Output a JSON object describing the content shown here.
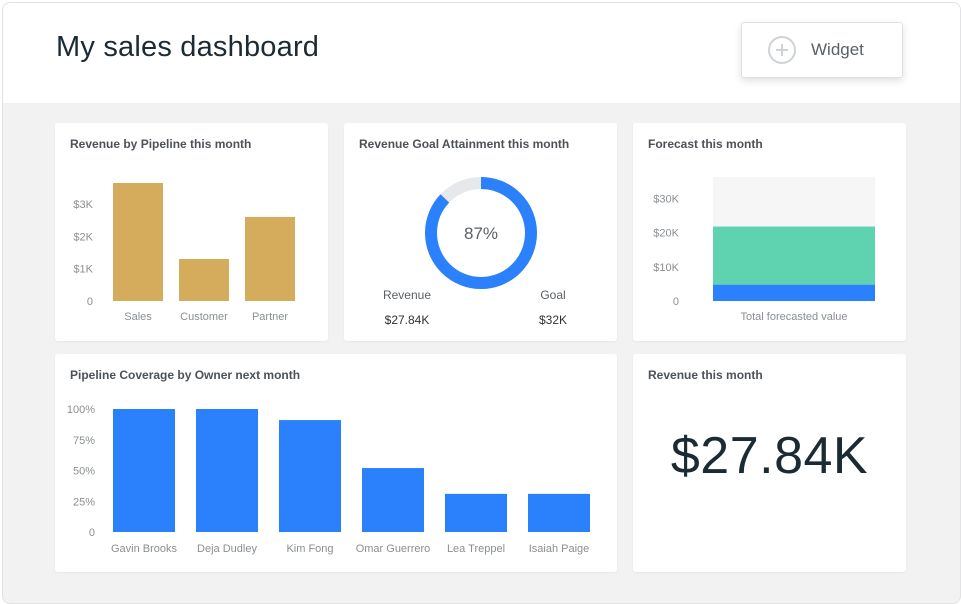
{
  "header": {
    "title": "My sales dashboard",
    "widget_button_label": "Widget",
    "widget_button_icon": "plus-circle-icon"
  },
  "colors": {
    "gold": "#d4ac5b",
    "blue": "#2b80fb",
    "teal": "#5fd3b0",
    "track": "#e6e8ec",
    "forecast_bg": "#f6f6f6",
    "text": "#1c2a33",
    "muted": "#8a8f93"
  },
  "cards": {
    "pipeline_revenue": {
      "title": "Revenue by Pipeline this month"
    },
    "goal": {
      "title": "Revenue Goal Attainment this month"
    },
    "forecast": {
      "title": "Forecast this month"
    },
    "coverage": {
      "title": "Pipeline Coverage by Owner next month"
    },
    "revenue": {
      "title": "Revenue this month",
      "value": "$27.84K"
    }
  },
  "chart_data": [
    {
      "id": "revenue-by-pipeline",
      "type": "bar",
      "title": "Revenue by Pipeline this month",
      "categories": [
        "Sales",
        "Customer",
        "Partner"
      ],
      "values": [
        3650,
        1300,
        2600
      ],
      "ylim": [
        0,
        3650
      ],
      "yticks": [
        0,
        1000,
        2000,
        3000
      ],
      "ytick_labels": [
        "0",
        "$1K",
        "$2K",
        "$3K"
      ],
      "color": "#d4ac5b"
    },
    {
      "id": "goal-attainment",
      "type": "pie",
      "title": "Revenue Goal Attainment this month",
      "percent": 87,
      "center_label": "87%",
      "labels": [
        "Revenue",
        "Goal"
      ],
      "display_values": [
        "$27.84K",
        "$32K"
      ],
      "colors": [
        "#2b80fb",
        "#e6e8ec"
      ]
    },
    {
      "id": "forecast",
      "type": "bar",
      "title": "Forecast this month",
      "categories": [
        "Total forecasted value"
      ],
      "stack": [
        4800,
        17000,
        14500
      ],
      "stack_colors": [
        "#2b80fb",
        "#5fd3b0",
        "#f6f6f6"
      ],
      "ylim": [
        0,
        36300
      ],
      "yticks": [
        0,
        10000,
        20000,
        30000
      ],
      "ytick_labels": [
        "0",
        "$10K",
        "$20K",
        "$30K"
      ]
    },
    {
      "id": "pipeline-coverage",
      "type": "bar",
      "title": "Pipeline Coverage by Owner next month",
      "categories": [
        "Gavin Brooks",
        "Deja Dudley",
        "Kim Fong",
        "Omar Guerrero",
        "Lea Treppel",
        "Isaiah Paige"
      ],
      "values": [
        100,
        100,
        91,
        52,
        31,
        31
      ],
      "ylim": [
        0,
        100
      ],
      "yticks": [
        0,
        25,
        50,
        75,
        100
      ],
      "ytick_labels": [
        "0",
        "25%",
        "50%",
        "75%",
        "100%"
      ],
      "color": "#2b80fb"
    }
  ]
}
